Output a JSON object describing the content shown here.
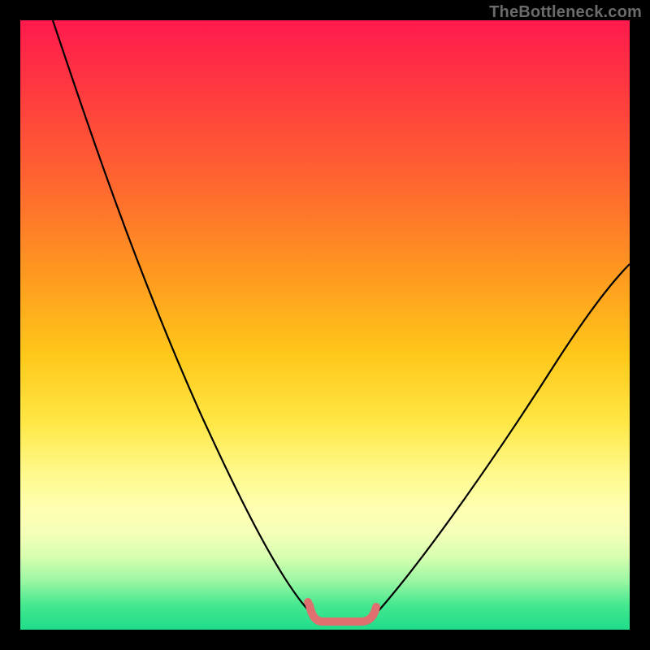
{
  "watermark": {
    "text": "TheBottleneck.com"
  },
  "chart_data": {
    "type": "line",
    "title": "",
    "xlabel": "",
    "ylabel": "",
    "xlim": [
      0,
      100
    ],
    "ylim": [
      0,
      100
    ],
    "grid": false,
    "series": [
      {
        "name": "left-curve",
        "color": "#000000",
        "x": [
          5,
          10,
          15,
          20,
          25,
          30,
          35,
          40,
          45,
          48
        ],
        "y": [
          100,
          88,
          76,
          64,
          52,
          40,
          29,
          18,
          8,
          3
        ]
      },
      {
        "name": "right-curve",
        "color": "#000000",
        "x": [
          58,
          62,
          67,
          72,
          77,
          82,
          87,
          92,
          97,
          100
        ],
        "y": [
          3,
          8,
          14,
          21,
          28,
          35,
          42,
          49,
          56,
          60
        ]
      },
      {
        "name": "bottom-squiggle",
        "color": "#e06f6f",
        "x": [
          47,
          48,
          49,
          50,
          52,
          54,
          56,
          57,
          58
        ],
        "y": [
          4,
          1,
          1,
          1,
          1,
          1,
          1,
          2,
          4
        ]
      }
    ],
    "annotations": [
      {
        "type": "dot",
        "series": "bottom-squiggle",
        "x": 47,
        "y": 4
      }
    ]
  }
}
